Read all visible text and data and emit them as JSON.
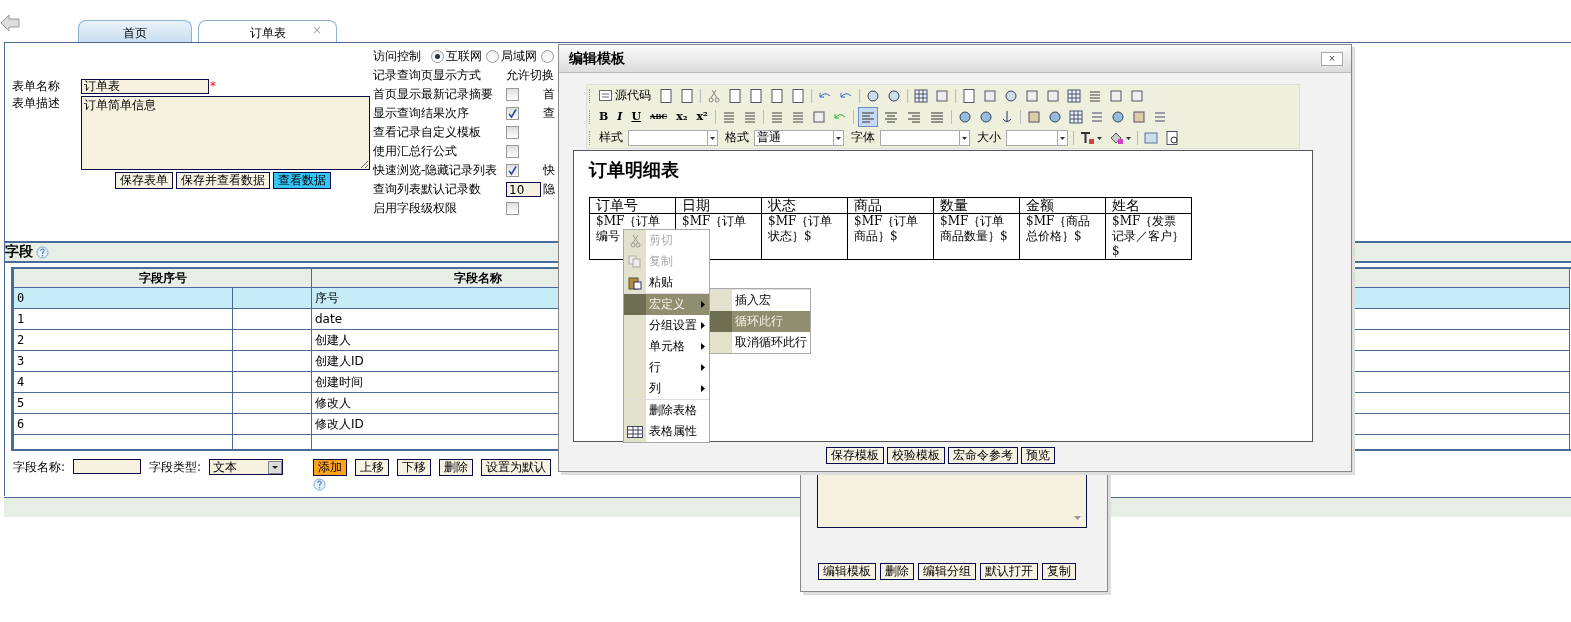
{
  "tabs": [
    {
      "label": "首页",
      "selected": false
    },
    {
      "label": "订单表",
      "selected": true,
      "close": "×"
    }
  ],
  "form": {
    "name_label": "表单名称",
    "name_value": "订单表",
    "required_mark": "*",
    "desc_label": "表单描述",
    "desc_value": "订单简单信息",
    "buttons": [
      {
        "label": "保存表单",
        "kind": "normal"
      },
      {
        "label": "保存并查看数据",
        "kind": "normal"
      },
      {
        "label": "查看数据",
        "kind": "primary"
      }
    ]
  },
  "settings": {
    "access_label": "访问控制",
    "access_options": [
      {
        "label": "互联网",
        "selected": true
      },
      {
        "label": "局域网",
        "selected": false
      },
      {
        "selected": false
      }
    ],
    "display_label": "记录查询页显示方式",
    "display_value": "允许切换",
    "rows": [
      {
        "kind": "checkbox",
        "label": "首页显示最新记录摘要",
        "checked": false,
        "extra": "首"
      },
      {
        "kind": "checkbox",
        "label": "显示查询结果次序",
        "checked": true,
        "extra": "查"
      },
      {
        "kind": "checkbox",
        "label": "查看记录自定义模板",
        "checked": false
      },
      {
        "kind": "checkbox",
        "label": "使用汇总行公式",
        "checked": false
      },
      {
        "kind": "checkbox",
        "label": "快速浏览-隐藏记录列表",
        "checked": true,
        "extra": "快"
      },
      {
        "kind": "number",
        "label": "查询列表默认记录数",
        "value": "10",
        "extra": "隐"
      },
      {
        "kind": "checkbox",
        "label": "启用字段级权限",
        "checked": false
      }
    ]
  },
  "fields": {
    "title": "字段",
    "columns": [
      "字段序号",
      "字段名称"
    ],
    "rows": [
      {
        "index": "0",
        "name": "序号",
        "selected": true
      },
      {
        "index": "1",
        "name": "date",
        "selected": false
      },
      {
        "index": "2",
        "name": "创建人",
        "selected": false
      },
      {
        "index": "3",
        "name": "创建人ID",
        "selected": false
      },
      {
        "index": "4",
        "name": "创建时间",
        "selected": false
      },
      {
        "index": "5",
        "name": "修改人",
        "selected": false
      },
      {
        "index": "6",
        "name": "修改人ID",
        "selected": false
      }
    ]
  },
  "field_editor": {
    "name_label": "字段名称:",
    "type_label": "字段类型:",
    "type_value": "文本",
    "buttons": [
      {
        "label": "添加",
        "kind": "primary"
      },
      {
        "label": "上移",
        "kind": "normal"
      },
      {
        "label": "下移",
        "kind": "normal"
      },
      {
        "label": "删除",
        "kind": "normal"
      },
      {
        "label": "设置为默认",
        "kind": "normal"
      }
    ]
  },
  "modal": {
    "title": "编辑模板",
    "close": "×",
    "toolbar": {
      "source_label": "源代码",
      "format_buttons": [
        "B",
        "I",
        "U",
        "ABC",
        "x₂",
        "x²"
      ],
      "align_buttons": [
        {
          "selected": true
        },
        {
          "selected": false
        },
        {
          "selected": false
        },
        {
          "selected": false
        }
      ],
      "selects": [
        {
          "label": "样式"
        },
        {
          "label": "格式",
          "value": "普通"
        },
        {
          "label": "字体"
        },
        {
          "label": "大小"
        }
      ]
    },
    "document": {
      "heading": "订单明细表",
      "columns": [
        "订单号",
        "日期",
        "状态",
        "商品",
        "数量",
        "金额",
        "姓名"
      ],
      "cells": [
        "$MF｛订单编号",
        "$MF｛订单",
        "$MF｛订单状态｝$",
        "$MF｛订单商品｝$",
        "$MF｛订单商品数量｝$",
        "$MF｛商品总价格｝$",
        "$MF｛发票记录／客户｝$"
      ]
    },
    "context_menu": [
      {
        "kind": "cut",
        "label": "剪切",
        "disabled": true,
        "selected": false
      },
      {
        "kind": "copy",
        "label": "复制",
        "disabled": true,
        "selected": false
      },
      {
        "kind": "paste",
        "label": "粘贴",
        "disabled": false,
        "selected": false
      },
      {
        "kind": "submenu",
        "label": "宏定义",
        "disabled": false,
        "selected": true
      },
      {
        "kind": "submenu",
        "label": "分组设置",
        "disabled": false,
        "selected": false
      },
      {
        "kind": "submenu",
        "label": "单元格",
        "disabled": false,
        "selected": false
      },
      {
        "kind": "submenu",
        "label": "行",
        "disabled": false,
        "selected": false
      },
      {
        "kind": "submenu",
        "label": "列",
        "disabled": false,
        "selected": false
      },
      {
        "kind": "plain",
        "label": "删除表格",
        "disabled": false,
        "selected": false
      },
      {
        "kind": "table",
        "label": "表格属性",
        "disabled": false,
        "selected": false
      }
    ],
    "submenu": [
      {
        "label": "插入宏",
        "selected": false
      },
      {
        "label": "循环此行",
        "selected": true
      },
      {
        "label": "取消循环此行",
        "selected": false
      }
    ],
    "buttons": [
      "保存模板",
      "校验模板",
      "宏命令参考",
      "预览"
    ]
  },
  "lower_panel": {
    "buttons": [
      "编辑模板",
      "删除",
      "编辑分组",
      "默认打开",
      "复制"
    ]
  }
}
